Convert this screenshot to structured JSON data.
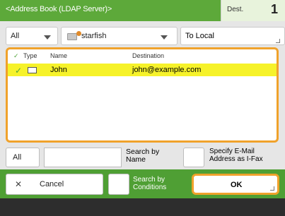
{
  "header": {
    "title": "<Address Book (LDAP Server)>",
    "dest_label": "Dest.",
    "dest_count": "1"
  },
  "filters": {
    "category_value": "All",
    "server_value": "starfish",
    "to_local_label": "To Local"
  },
  "list": {
    "columns": {
      "type": "Type",
      "name": "Name",
      "destination": "Destination"
    },
    "rows": [
      {
        "name": "John",
        "destination": "john@example.com",
        "selected": true
      }
    ]
  },
  "search_row": {
    "all_label": "All",
    "search_by_name_label": "Search by Name",
    "specify_label": "Specify E-Mail Address as I-Fax"
  },
  "actions": {
    "cancel_label": "Cancel",
    "search_by_conditions_label": "Search by Conditions",
    "ok_label": "OK"
  },
  "colors": {
    "header_green": "#5da93a",
    "action_bar_green": "#4f9f34",
    "highlight_orange": "#f0a22b",
    "selected_row_yellow": "#f6f22a"
  }
}
